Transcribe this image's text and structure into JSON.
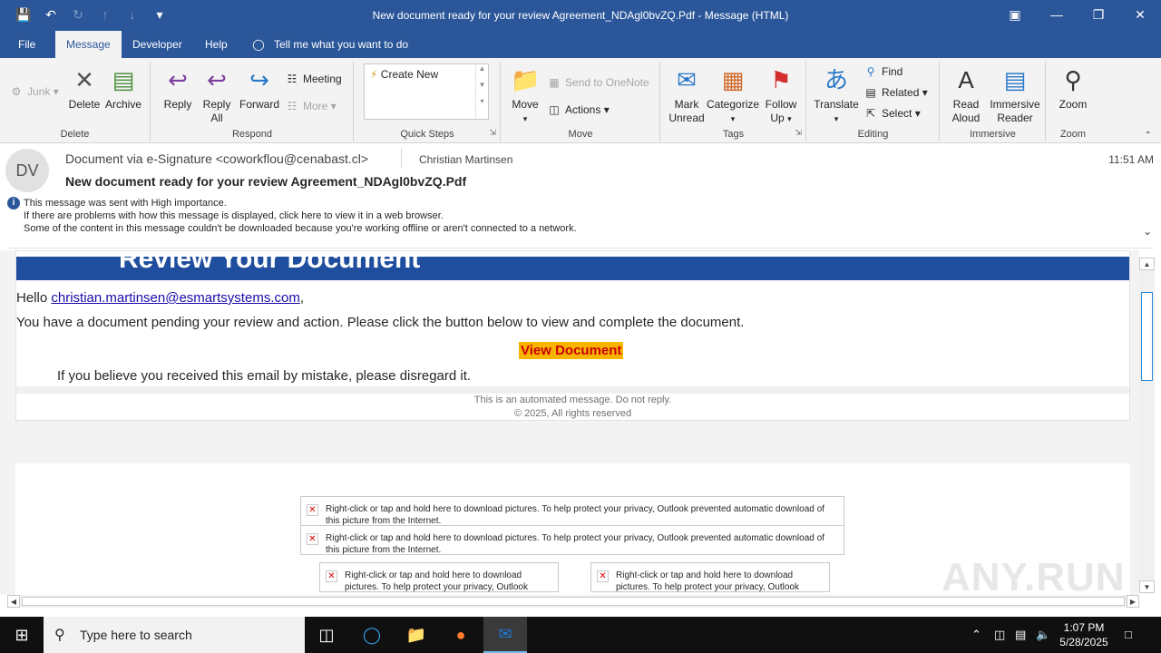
{
  "window": {
    "title": "New document ready for your review Agreement_NDAgl0bvZQ.Pdf  -  Message (HTML)"
  },
  "tabs": {
    "file": "File",
    "message": "Message",
    "developer": "Developer",
    "help": "Help",
    "tell_me": "Tell me what you want to do"
  },
  "ribbon": {
    "junk": "Junk",
    "delete": "Delete",
    "archive": "Archive",
    "delete_group": "Delete",
    "reply": "Reply",
    "reply_all_1": "Reply",
    "reply_all_2": "All",
    "forward": "Forward",
    "meeting": "Meeting",
    "more": "More",
    "respond_group": "Respond",
    "create_new": "Create New",
    "quick_steps_group": "Quick Steps",
    "move": "Move",
    "send_onenote": "Send to OneNote",
    "actions": "Actions",
    "move_group": "Move",
    "mark_unread_1": "Mark",
    "mark_unread_2": "Unread",
    "categorize": "Categorize",
    "follow_up_1": "Follow",
    "follow_up_2": "Up",
    "tags_group": "Tags",
    "translate": "Translate",
    "find": "Find",
    "related": "Related",
    "select": "Select",
    "editing_group": "Editing",
    "read_aloud_1": "Read",
    "read_aloud_2": "Aloud",
    "immersive_reader_1": "Immersive",
    "immersive_reader_2": "Reader",
    "immersive_group": "Immersive",
    "zoom": "Zoom",
    "zoom_group": "Zoom"
  },
  "message": {
    "avatar_initials": "DV",
    "from": "Document via e-Signature <coworkflou@cenabast.cl>",
    "to": "Christian Martinsen",
    "time": "11:51 AM",
    "subject": "New document ready for your review Agreement_NDAgl0bvZQ.Pdf",
    "info_1": "This message was sent with High importance.",
    "info_2": "If there are problems with how this message is displayed, click here to view it in a web browser.",
    "info_3": "Some of the content in this message couldn't be downloaded because you're working offline or aren't connected to a network."
  },
  "email_body": {
    "banner": "Review Your Document",
    "hello": "Hello ",
    "email_link": "christian.martinsen@esmartsystems.com",
    "comma": ",",
    "pending": "You have a document pending your review and action. Please click the button below to view and complete the document.",
    "view_button": "View Document",
    "mistake": "If you believe you received this email by mistake, please disregard it.",
    "automated": "This is an automated message. Do not reply.",
    "copyright": "© 2025, All rights reserved",
    "blocked_pic_wide": "Right-click or tap and hold here to download pictures. To help protect your privacy, Outlook prevented automatic download of this picture from the Internet.",
    "blocked_pic_narrow": "Right-click or tap and hold here to download pictures. To help protect your privacy, Outlook prevented automatic download of this picture from the Internet."
  },
  "watermark": "ANY.RUN",
  "taskbar": {
    "search_placeholder": "Type here to search",
    "time": "1:07 PM",
    "date": "5/28/2025"
  },
  "colors": {
    "accent": "#2b579a",
    "banner": "#1f4e9e",
    "button_bg": "#f8b500",
    "button_text": "#cc0000"
  }
}
